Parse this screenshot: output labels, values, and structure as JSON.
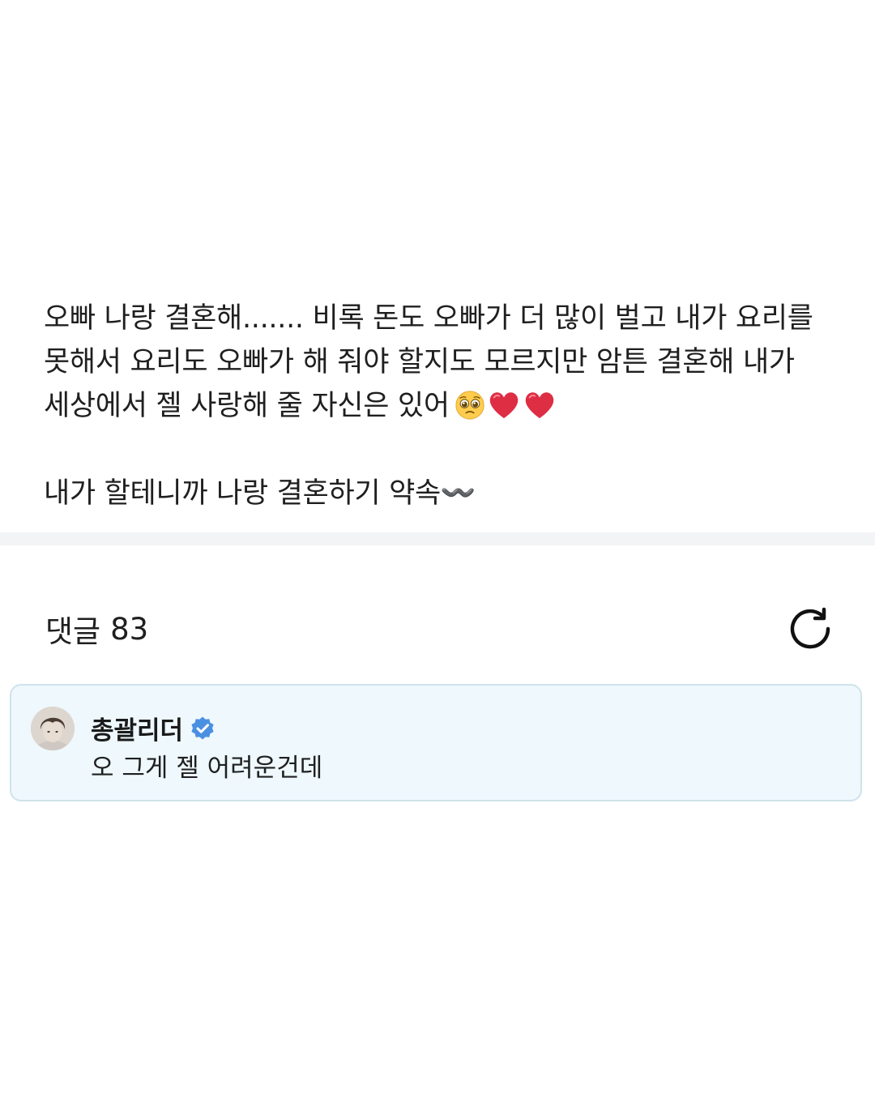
{
  "post": {
    "line1": "오빠 나랑 결혼해....... 비록 돈도 오빠가 더 많이 벌고 내가 요리를",
    "line2": "못해서 요리도 오빠가 해 줘야 할지도 모르지만 암튼 결혼해 내가",
    "line3": "세상에서 젤 사랑해 줄 자신은 있어",
    "line4": "내가 할테니까 나랑 결혼하기 약속〰️",
    "emojis": [
      "pleading-face-emoji",
      "red-heart-emoji",
      "red-heart-emoji"
    ]
  },
  "comments": {
    "label": "댓글",
    "count": "83",
    "refresh_icon": "refresh-icon"
  },
  "comment": {
    "author": "총괄리더",
    "text": "오 그게 젤 어려운건데",
    "verified": true,
    "badge_color": "#4a90e2",
    "card_background": "#eef8fd",
    "card_border": "#cfe3ea"
  }
}
